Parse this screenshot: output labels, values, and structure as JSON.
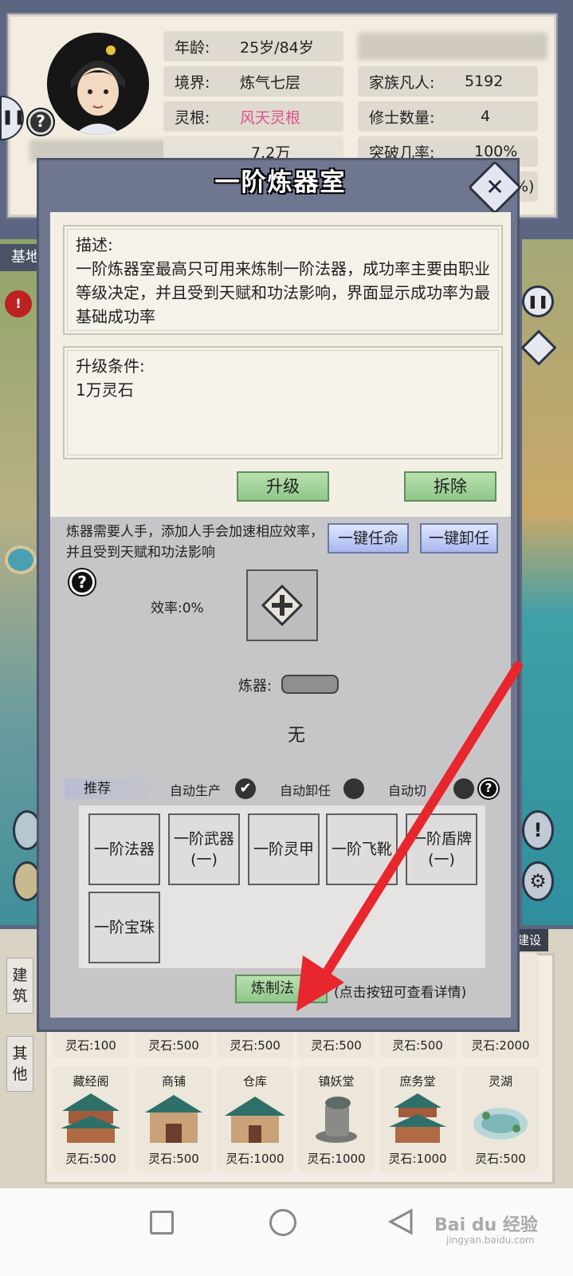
{
  "profile": {
    "age_label": "年龄:",
    "age_value": "25岁/84岁",
    "realm_label": "境界:",
    "realm_value": "炼气七层",
    "root_label": "灵根:",
    "root_value": "风天灵根",
    "root_color": "#e0508a",
    "money_value": "7.2万",
    "family_label": "家族凡人:",
    "family_value": "5192",
    "cultivator_label": "修士数量:",
    "cultivator_value": "4",
    "breakthrough_label": "突破几率:",
    "breakthrough_value": "100%",
    "partial_percent": "%)",
    "help_icon": "?"
  },
  "background": {
    "base_tab": "基地",
    "build_tab": "建设",
    "side_tab_build": "建\n筑",
    "side_tab_other": "其\n他",
    "buildings_row1_prices": [
      "灵石:100",
      "灵石:500",
      "灵石:500",
      "灵石:500",
      "灵石:500",
      "灵石:2000"
    ],
    "buildings_row2": [
      {
        "name": "藏经阁",
        "price": "灵石:500"
      },
      {
        "name": "商铺",
        "price": "灵石:500"
      },
      {
        "name": "仓库",
        "price": "灵石:1000"
      },
      {
        "name": "镇妖堂",
        "price": "灵石:1000"
      },
      {
        "name": "庶务堂",
        "price": "灵石:1000"
      },
      {
        "name": "灵湖",
        "price": "灵石:500"
      }
    ]
  },
  "modal": {
    "title": "一阶炼器室",
    "close_icon": "close-icon",
    "desc_label": "描述:",
    "desc_text": "一阶炼器室最高只可用来炼制一阶法器，成功率主要由职业等级决定，并且受到天赋和功法影响，界面显示成功率为最基础成功率",
    "upgrade_label": "升级条件:",
    "upgrade_cost": "1万灵石",
    "upgrade_button": "升级",
    "demolish_button": "拆除",
    "staff_hint": "炼器需要人手，添加人手会加速相应效率，并且受到天赋和功法影响",
    "appoint_all_button": "一键任命",
    "dismiss_all_button": "一键卸任",
    "help_icon": "?",
    "efficiency_text": "效率:0%",
    "add_icon": "plus-icon",
    "craft_label": "炼器:",
    "craft_value": "无",
    "recommend_label": "推荐",
    "auto_produce_label": "自动生产",
    "auto_produce_checked": true,
    "auto_dismiss_label": "自动卸任",
    "auto_switch_label": "自动切",
    "recipes": [
      "一阶法器",
      "一阶武器\n(一)",
      "一阶灵甲",
      "一阶飞靴",
      "一阶盾牌\n(一)",
      "一阶宝珠"
    ],
    "craft_button": "炼制法",
    "craft_hint": "(点击按钮可查看详情)"
  },
  "watermark": "Bai du 经验",
  "watermark_sub": "jingyan.baidu.com"
}
